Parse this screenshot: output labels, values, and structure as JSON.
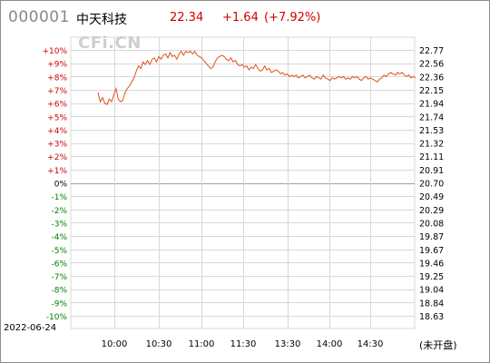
{
  "header": {
    "code": "000001",
    "name": "中天科技",
    "price": "22.34",
    "change": "+1.64",
    "change_pct": "(+7.92%)"
  },
  "watermark": "CFi.CN",
  "date": "2022-06-24",
  "status": "(未开盘)",
  "colors": {
    "up": "#d00000",
    "down": "#008000",
    "zero": "#000000",
    "line": "#e0521a",
    "grid": "#d8d8d8",
    "baseline": "#a0a0a0"
  },
  "chart_data": {
    "type": "line",
    "xlabels": [
      "10:00",
      "10:30",
      "11:00",
      "11:30",
      "13:30",
      "14:00",
      "14:30"
    ],
    "left_ticks": [
      "+10%",
      "+9%",
      "+8%",
      "+7%",
      "+6%",
      "+5%",
      "+4%",
      "+3%",
      "+2%",
      "+1%",
      "0%",
      "-1%",
      "-2%",
      "-3%",
      "-4%",
      "-5%",
      "-6%",
      "-7%",
      "-8%",
      "-9%",
      "-10%"
    ],
    "right_ticks": [
      "22.77",
      "22.56",
      "22.36",
      "22.15",
      "21.94",
      "21.74",
      "21.53",
      "21.32",
      "21.11",
      "20.91",
      "20.70",
      "20.49",
      "20.29",
      "20.08",
      "19.87",
      "19.67",
      "19.46",
      "19.25",
      "19.04",
      "18.84",
      "18.63"
    ],
    "pct_range": [
      -10,
      10
    ],
    "pre_close": 20.7,
    "series": [
      {
        "values": [
          6.8,
          6.1,
          6.4,
          6.0,
          5.9,
          6.3,
          6.1,
          6.6,
          7.1,
          6.3,
          6.1,
          6.2,
          6.8,
          7.1,
          7.3,
          7.6,
          7.9,
          8.4,
          8.8,
          8.6,
          9.1,
          8.9,
          9.2,
          8.9,
          9.3,
          9.4,
          9.1,
          9.5,
          9.3,
          9.6,
          9.7,
          9.4,
          9.8,
          9.5,
          9.6,
          9.3,
          9.7,
          9.9,
          9.6,
          9.9,
          9.8,
          9.9,
          9.7,
          9.9,
          9.6,
          9.5,
          9.4,
          9.2,
          9.0,
          8.8,
          8.6,
          8.7,
          9.1,
          9.4,
          9.5,
          9.6,
          9.5,
          9.3,
          9.2,
          9.4,
          9.1,
          9.2,
          8.9,
          8.8,
          8.9,
          8.7,
          8.8,
          8.5,
          8.7,
          8.6,
          8.9,
          8.6,
          8.4,
          8.5,
          8.8,
          8.5,
          8.6,
          8.3,
          8.4,
          8.5,
          8.4,
          8.2,
          8.3,
          8.1,
          8.2,
          8.0,
          8.1,
          8.0,
          8.1,
          7.9,
          8.0,
          8.1,
          7.9,
          8.0,
          8.1,
          7.9,
          7.8,
          8.0,
          7.9,
          7.8,
          8.1,
          7.9,
          7.8,
          7.7,
          7.9,
          7.8,
          7.9,
          8.0,
          7.9,
          8.0,
          7.8,
          7.9,
          7.8,
          8.0,
          7.9,
          8.0,
          7.8,
          7.7,
          7.9,
          8.0,
          7.8,
          7.9,
          7.8,
          7.7,
          7.6,
          7.8,
          7.9,
          8.1,
          8.0,
          8.2,
          8.3,
          8.2,
          8.1,
          8.3,
          8.2,
          8.3,
          8.1,
          8.0,
          8.1,
          7.9,
          8.0,
          7.9
        ]
      }
    ]
  }
}
